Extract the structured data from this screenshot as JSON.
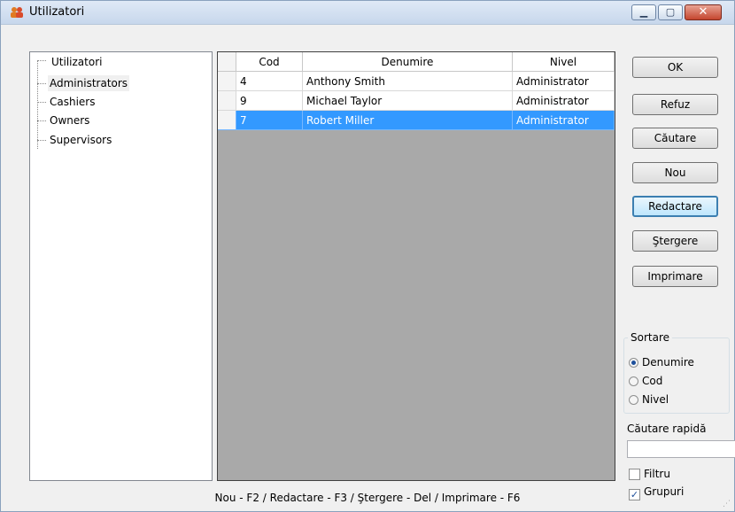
{
  "window": {
    "title": "Utilizatori",
    "min_icon": "minimize-icon",
    "max_icon": "maximize-icon",
    "close_icon": "close-icon"
  },
  "tree": {
    "root": "Utilizatori",
    "items": [
      "Administrators",
      "Cashiers",
      "Owners",
      "Supervisors"
    ],
    "selected": "Administrators"
  },
  "grid": {
    "columns": [
      "Cod",
      "Denumire",
      "Nivel"
    ],
    "rows": [
      {
        "cod": "4",
        "denumire": "Anthony Smith",
        "nivel": "Administrator"
      },
      {
        "cod": "9",
        "denumire": "Michael Taylor",
        "nivel": "Administrator"
      },
      {
        "cod": "7",
        "denumire": "Robert Miller",
        "nivel": "Administrator"
      }
    ],
    "selected_row": 3
  },
  "buttons": {
    "ok": "OK",
    "refuz": "Refuz",
    "cautare": "Căutare",
    "nou": "Nou",
    "redactare": "Redactare",
    "stergere": "Ştergere",
    "imprimare": "Imprimare"
  },
  "sortare": {
    "label": "Sortare",
    "options": [
      "Denumire",
      "Cod",
      "Nivel"
    ],
    "selected": "Denumire"
  },
  "quick_search": {
    "label": "Căutare rapidă",
    "value": ""
  },
  "filters": {
    "filtru": {
      "label": "Filtru",
      "checked": false
    },
    "grupuri": {
      "label": "Grupuri",
      "checked": true
    }
  },
  "status": "Nou - F2 / Redactare - F3 / Ştergere - Del / Imprimare - F6",
  "colors": {
    "selection": "#3399ff",
    "grid_bg": "#a9a9a9",
    "close_button": "#c4452e"
  }
}
